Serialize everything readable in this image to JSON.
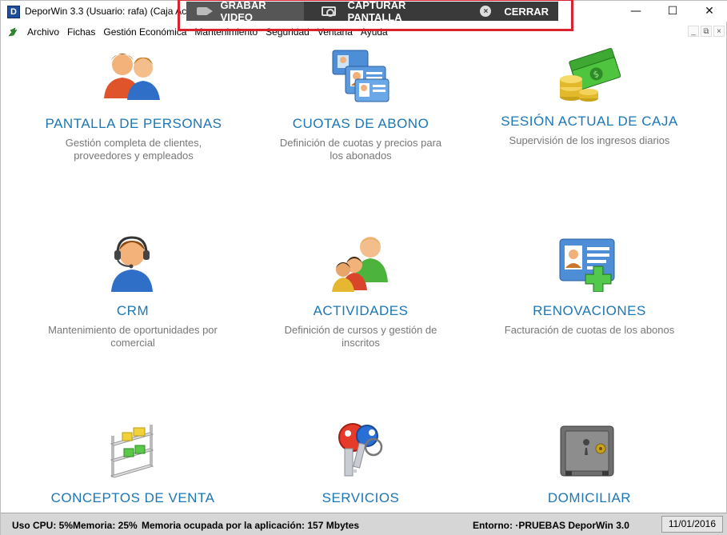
{
  "window": {
    "app_icon_letter": "D",
    "title": "DeporWin 3.3  (Usuario: rafa)  (Caja Ac",
    "minimize": "—",
    "maximize": "☐",
    "close": "✕"
  },
  "recorder": {
    "record_label": "GRABAR VIDEO",
    "capture_label": "CAPTURAR PANTALLA",
    "close_label": "CERRAR",
    "close_glyph": "×"
  },
  "menu": {
    "items": [
      "Archivo",
      "Fichas",
      "Gestión Económica",
      "Mantenimiento",
      "Seguridad",
      "Ventana",
      "Ayuda"
    ],
    "mdi": [
      "_",
      "⧉",
      "×"
    ]
  },
  "tiles": [
    {
      "title": "PANTALLA DE PERSONAS",
      "desc": "Gestión completa de clientes, proveedores y empleados",
      "icon": "people-icon"
    },
    {
      "title": "CUOTAS DE ABONO",
      "desc": "Definición de cuotas y precios para los abonados",
      "icon": "id-cards-icon"
    },
    {
      "title": "SESIÓN ACTUAL DE CAJA",
      "desc": "Supervisión de los ingresos diarios",
      "icon": "money-icon"
    },
    {
      "title": "CRM",
      "desc": "Mantenimiento de oportunidades por comercial",
      "icon": "headset-user-icon"
    },
    {
      "title": "ACTIVIDADES",
      "desc": "Definición de cursos y gestión de inscritos",
      "icon": "group-icon"
    },
    {
      "title": "RENOVACIONES",
      "desc": "Facturación de cuotas de los abonos",
      "icon": "id-card-plus-icon"
    },
    {
      "title": "CONCEPTOS DE VENTA",
      "desc": "",
      "icon": "shelf-icon"
    },
    {
      "title": "SERVICIOS",
      "desc": "",
      "icon": "keys-icon"
    },
    {
      "title": "DOMICILIAR",
      "desc": "",
      "icon": "safe-icon"
    }
  ],
  "status": {
    "cpu": "Uso CPU: 5%",
    "memory": "Memoria: 25%",
    "app_memory": "Memoria ocupada por la aplicación: 157 Mbytes",
    "environment": "Entorno: ·PRUEBAS DeporWin 3.0",
    "date": "11/01/2016"
  },
  "colors": {
    "tile_title": "#1b77b5",
    "tile_desc": "#777777",
    "highlight_frame": "#d9232e",
    "recorder_bg": "#3a3a3a"
  }
}
